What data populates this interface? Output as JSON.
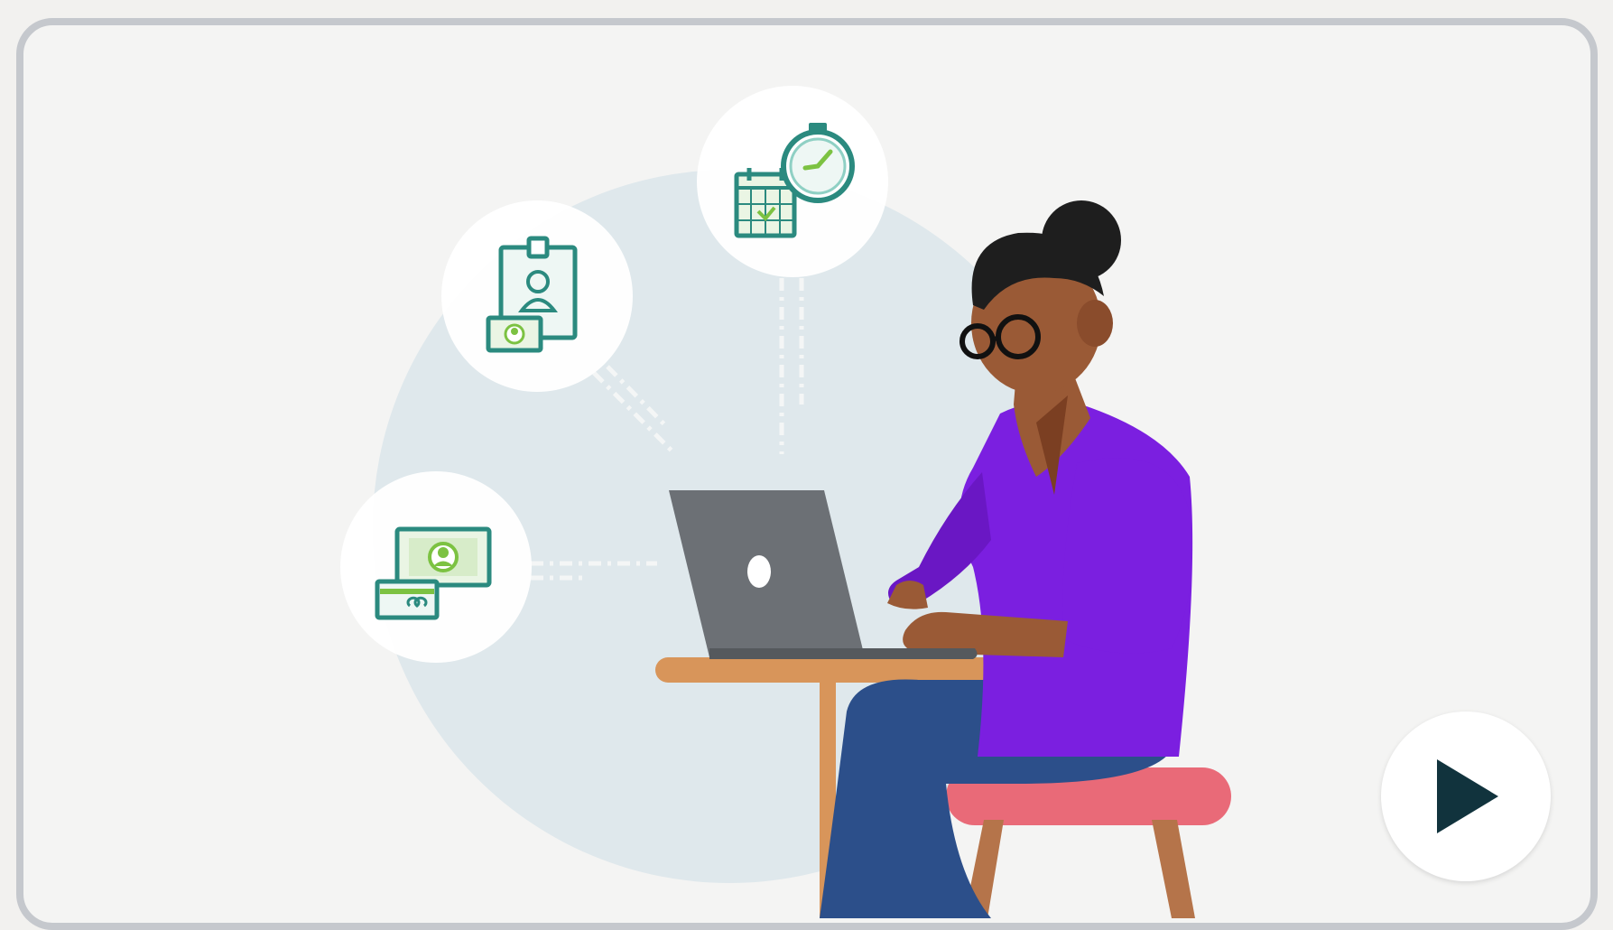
{
  "video": {
    "state": "paused",
    "illustration": {
      "icons": [
        "payment-icon",
        "employee-badge-icon",
        "calendar-clock-icon",
        "laptop-icon"
      ]
    },
    "controls": {
      "play_icon": "play-icon"
    }
  },
  "colors": {
    "frame_border": "#c5c8cd",
    "background": "#f4f4f3",
    "backdrop_circle": "#dfe8ec",
    "icon_teal": "#2b8a7f",
    "icon_green": "#7cc242",
    "shirt_purple": "#7b1fe0",
    "pants_blue": "#2c4f8a",
    "stool_pink": "#e96a78",
    "table_tan": "#d8955a",
    "laptop_grey": "#6c7075",
    "skin": "#9a5a36",
    "play_icon": "#11333d"
  }
}
